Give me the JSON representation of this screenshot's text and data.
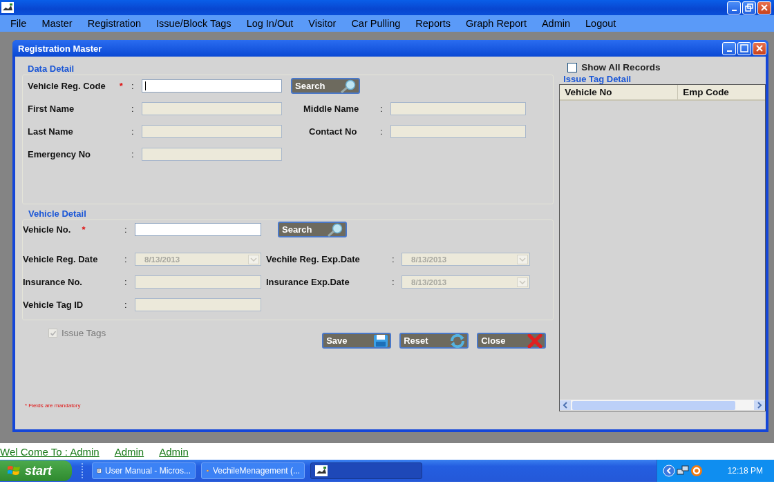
{
  "menu": [
    {
      "label": "File"
    },
    {
      "label": "Master"
    },
    {
      "label": "Registration"
    },
    {
      "label": "Issue/Block Tags"
    },
    {
      "label": "Log In/Out"
    },
    {
      "label": "Visitor"
    },
    {
      "label": "Car Pulling"
    },
    {
      "label": "Reports"
    },
    {
      "label": "Graph Report"
    },
    {
      "label": "Admin"
    },
    {
      "label": "Logout"
    }
  ],
  "child_window": {
    "title": "Registration Master"
  },
  "data_detail": {
    "title": "Data Detail",
    "rows": [
      [
        {
          "kind": "field",
          "label": "Vehicle Reg. Code",
          "required_mark": "*",
          "colon": ":",
          "disabled": false
        },
        {
          "kind": "search",
          "label": "Search"
        }
      ],
      [
        {
          "kind": "field",
          "label": "First Name",
          "colon": ":",
          "disabled": true
        },
        {
          "kind": "field",
          "label": "Middle Name",
          "colon": ":",
          "disabled": true
        }
      ],
      [
        {
          "kind": "field",
          "label": "Last Name",
          "colon": ":",
          "disabled": true
        },
        {
          "kind": "field",
          "label": "Contact No",
          "colon": ":",
          "disabled": true
        }
      ],
      [
        {
          "kind": "field",
          "label": "Emergency No",
          "colon": ":",
          "disabled": true
        }
      ]
    ]
  },
  "vehicle_detail": {
    "title": "Vehicle Detail",
    "rows": [
      [
        {
          "kind": "field",
          "label": "Vehicle No.",
          "required_mark": "*",
          "colon": ":",
          "disabled": false
        },
        {
          "kind": "search",
          "label": "Search"
        }
      ],
      [
        {
          "kind": "date",
          "label": "Vehicle Reg. Date",
          "colon": ":",
          "value": "8/13/2013",
          "disabled": true
        },
        {
          "kind": "date",
          "label": "Vechile Reg. Exp.Date",
          "colon": ":",
          "value": "8/13/2013",
          "disabled": true
        }
      ],
      [
        {
          "kind": "field",
          "label": "Insurance No.",
          "colon": ":",
          "disabled": true
        },
        {
          "kind": "date",
          "label": "Insurance Exp.Date",
          "colon": ":",
          "value": "8/13/2013",
          "disabled": true
        }
      ],
      [
        {
          "kind": "field",
          "label": "Vehicle Tag ID",
          "colon": ":",
          "disabled": true
        }
      ]
    ]
  },
  "issue_tags": {
    "label": "Issue Tags",
    "checked": true,
    "disabled": true
  },
  "buttons": [
    {
      "kind": "save",
      "label": "Save"
    },
    {
      "kind": "reset",
      "label": "Reset"
    },
    {
      "kind": "close",
      "label": "Close"
    }
  ],
  "mandatory_note": "* Fields are mandatory",
  "show_all_records": {
    "label": "Show All Records",
    "checked": false
  },
  "issue_tag_detail": {
    "title": "Issue Tag Detail",
    "columns": [
      "Vehicle No",
      "Emp Code"
    ]
  },
  "welcome": [
    "Wel Come To : Admin",
    "Admin",
    "Admin"
  ],
  "taskbar": {
    "start": "start",
    "tasks": [
      {
        "kind": "document",
        "label": "User Manual - Micros...",
        "selected": false
      },
      {
        "kind": "app",
        "label": "VechileMenagement (...",
        "selected": false
      },
      {
        "kind": "app-window",
        "selected": true
      }
    ],
    "clock": "12:18 PM"
  }
}
